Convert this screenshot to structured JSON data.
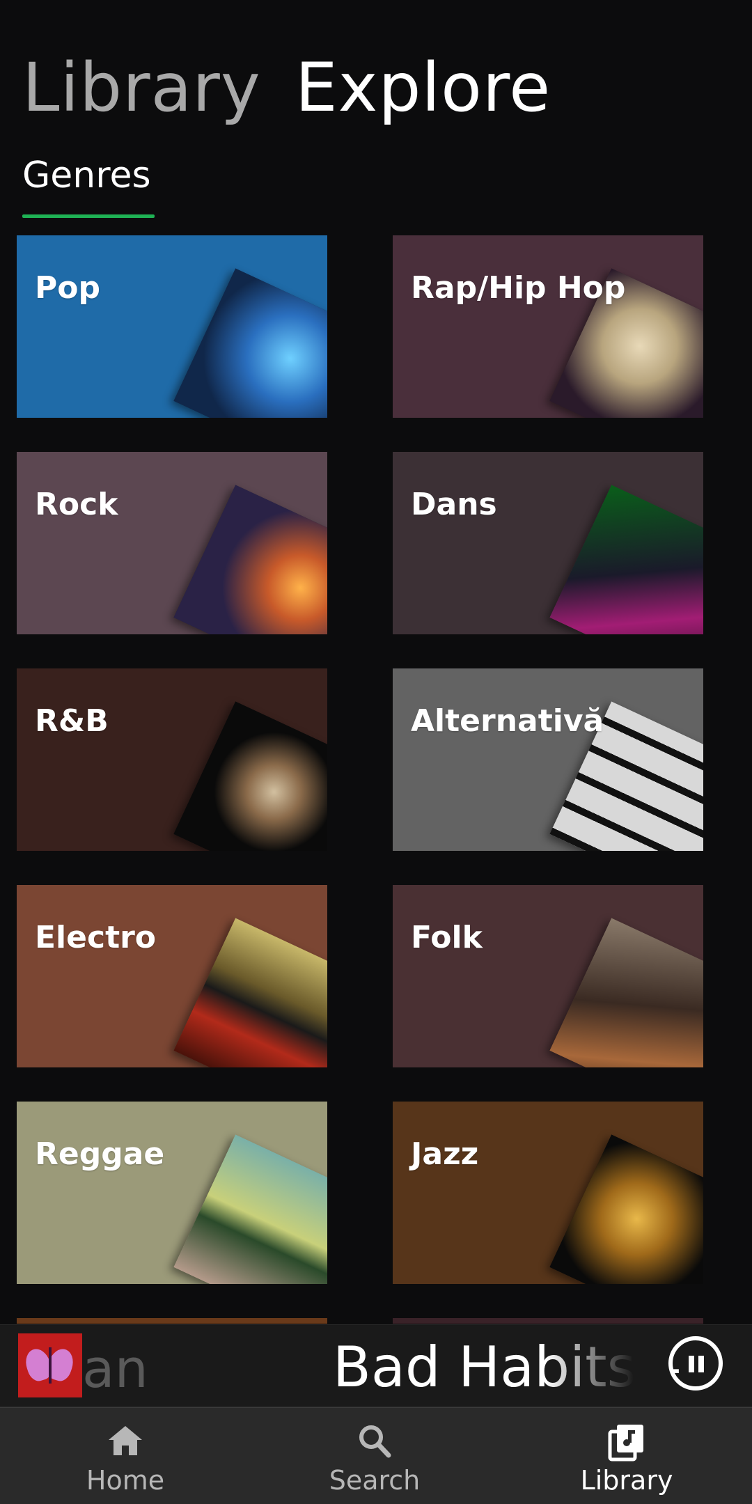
{
  "header": {
    "tab_library": "Library",
    "tab_explore": "Explore",
    "subtab": "Genres",
    "accent_color": "#1fb254"
  },
  "genres": [
    {
      "label": "Pop",
      "bg": "#1f6ba8",
      "art": "pop-concert-lights"
    },
    {
      "label": "Rap/Hip Hop",
      "bg": "#4a2f3b",
      "art": "turntable"
    },
    {
      "label": "Rock",
      "bg": "#5c4751",
      "art": "rock-guitar-stage"
    },
    {
      "label": "Dans",
      "bg": "#3c3035",
      "art": "laser-dance-floor"
    },
    {
      "label": "R&B",
      "bg": "#39211d",
      "art": "vintage-microphone"
    },
    {
      "label": "Alternativă",
      "bg": "#636363",
      "art": "piano-keys"
    },
    {
      "label": "Electro",
      "bg": "#7b4633",
      "art": "equalizer"
    },
    {
      "label": "Folk",
      "bg": "#4a3033",
      "art": "acoustic-guitar"
    },
    {
      "label": "Reggae",
      "bg": "#9b9a79",
      "art": "palm-trees"
    },
    {
      "label": "Jazz",
      "bg": "#57351a",
      "art": "saxophone"
    }
  ],
  "miniplayer": {
    "prev_title_fragment": "an",
    "title": "Bad Habits –",
    "art_icon": "butterfly-album-art"
  },
  "bottomnav": {
    "items": [
      {
        "label": "Home",
        "icon": "home-icon",
        "active": false
      },
      {
        "label": "Search",
        "icon": "search-icon",
        "active": false
      },
      {
        "label": "Library",
        "icon": "library-icon",
        "active": true
      }
    ]
  }
}
